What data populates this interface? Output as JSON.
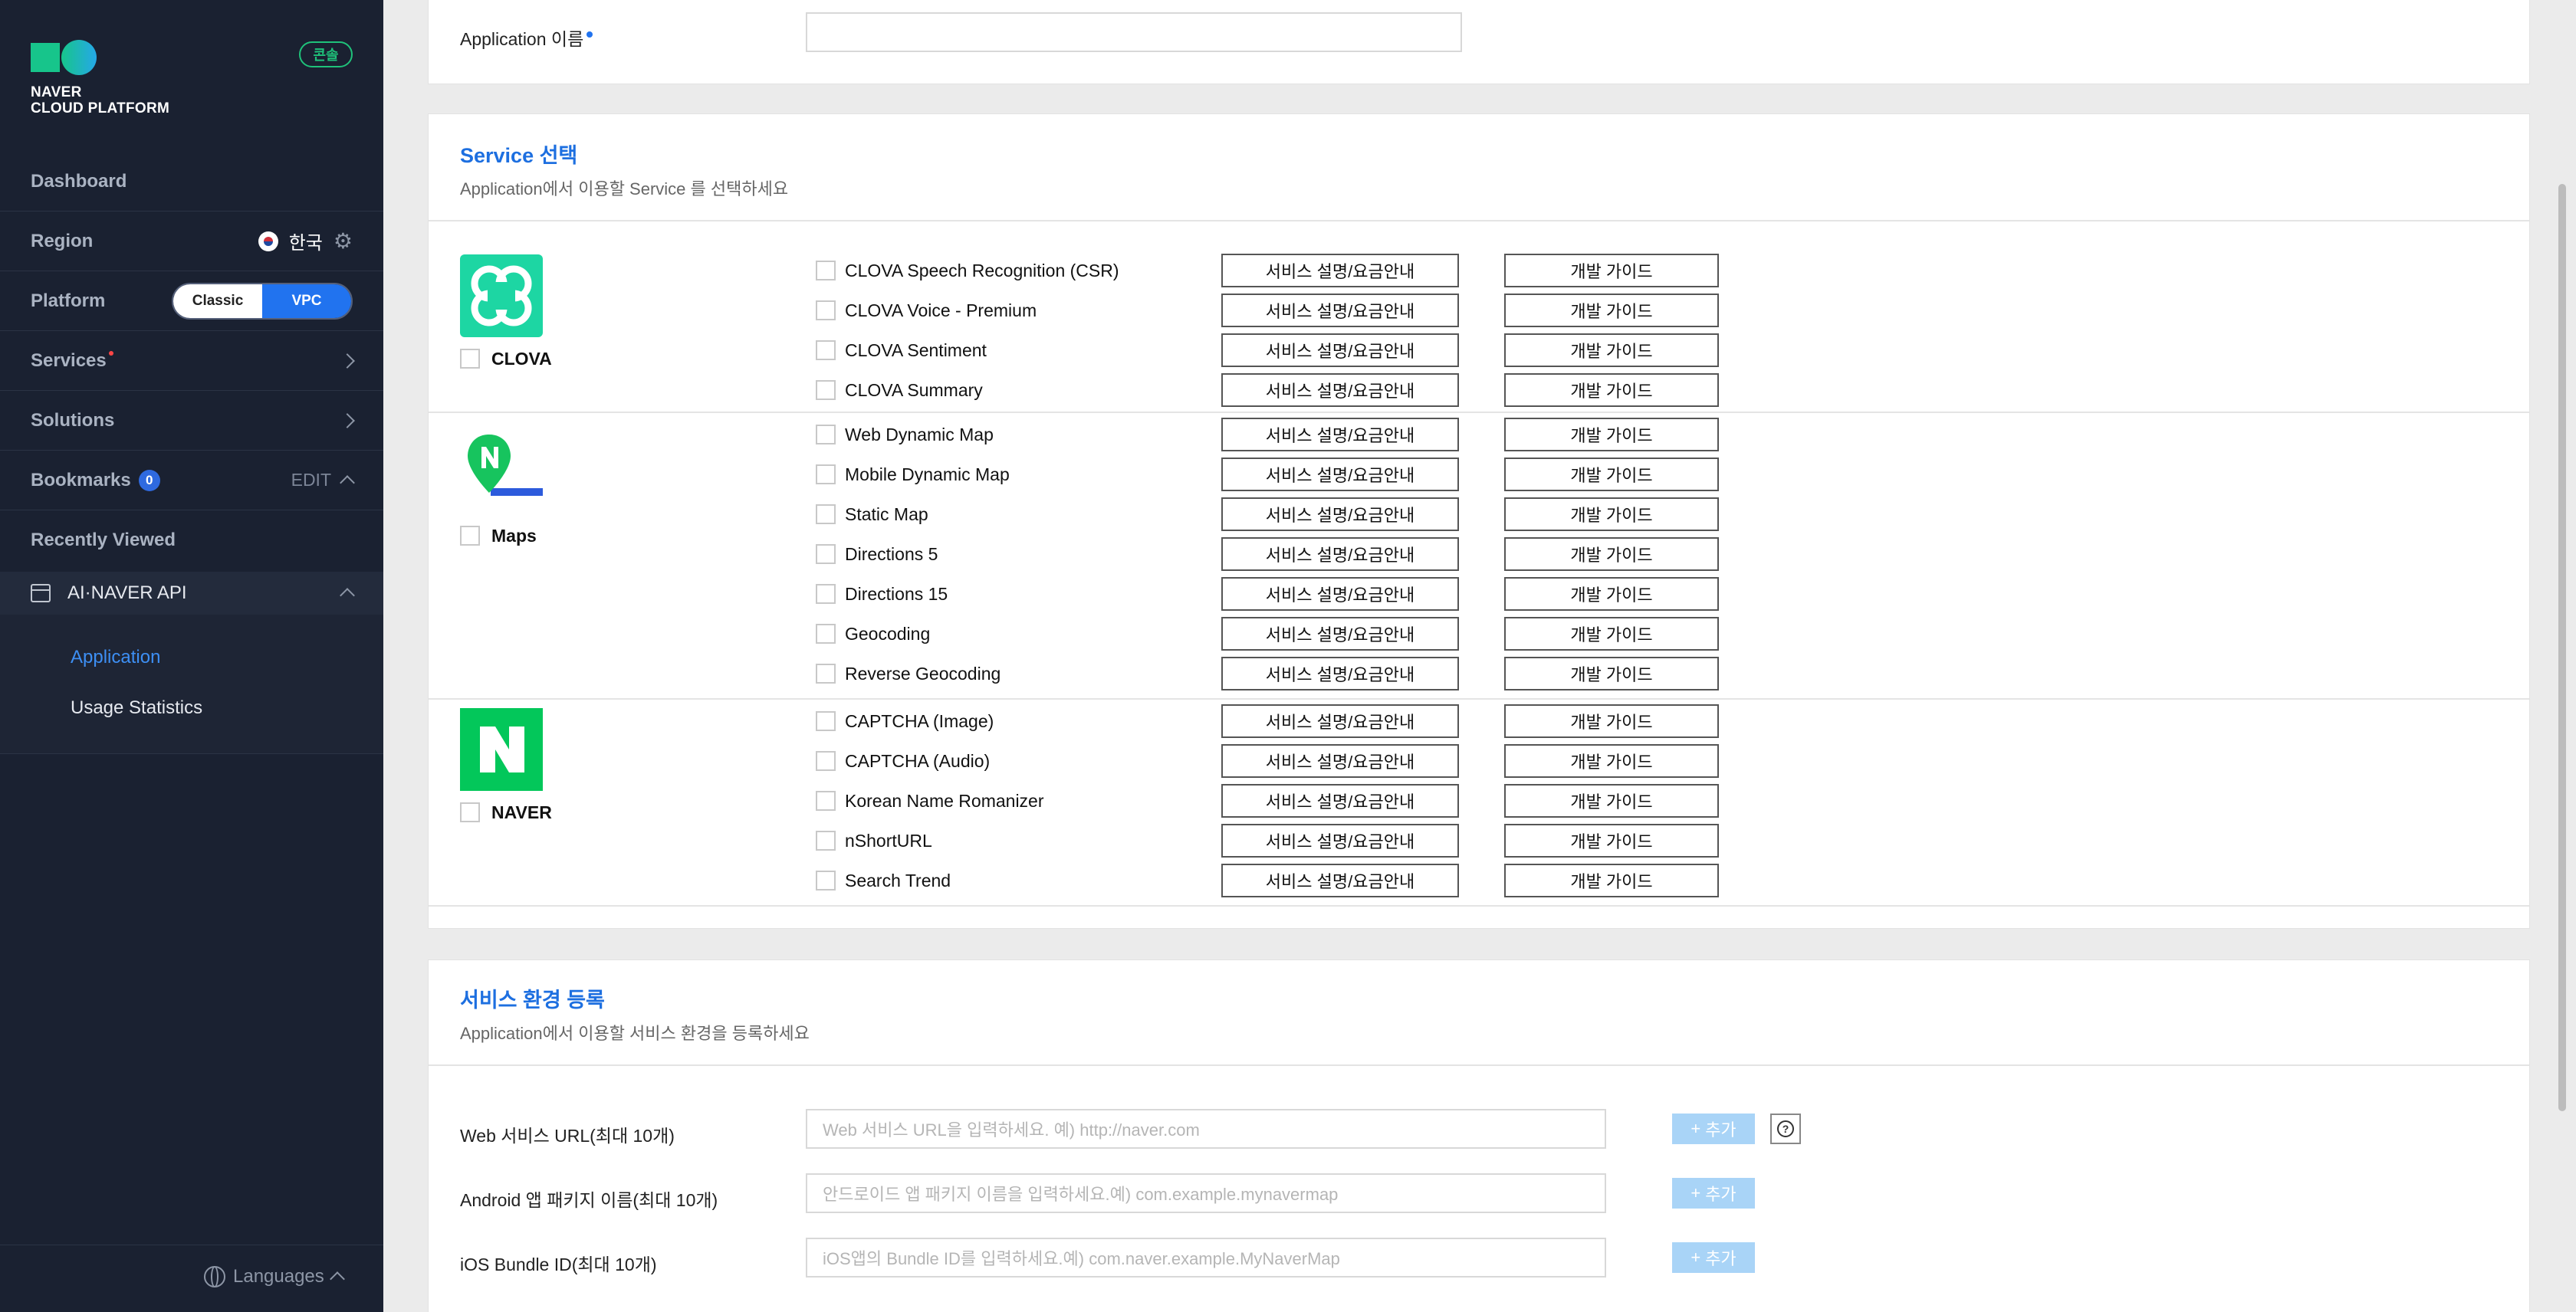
{
  "sidebar": {
    "logo_line1": "NAVER",
    "logo_line2": "CLOUD PLATFORM",
    "console_badge": "콘솔",
    "dashboard": "Dashboard",
    "region_label": "Region",
    "region_value": "한국",
    "platform_label": "Platform",
    "platform_classic": "Classic",
    "platform_vpc": "VPC",
    "services": "Services",
    "solutions": "Solutions",
    "bookmarks": "Bookmarks",
    "bookmarks_count": "0",
    "bookmarks_edit": "EDIT",
    "recently_viewed": "Recently Viewed",
    "api_group": "AI·NAVER API",
    "sub_items": [
      "Application",
      "Usage Statistics"
    ],
    "languages": "Languages"
  },
  "app_name": {
    "label": "Application 이름"
  },
  "service_select": {
    "title": "Service 선택",
    "subtitle": "Application에서 이용할 Service 를 선택하세요",
    "desc_button": "서비스 설명/요금안내",
    "guide_button": "개발 가이드",
    "groups": [
      {
        "name": "CLOVA",
        "services": [
          "CLOVA Speech Recognition (CSR)",
          "CLOVA Voice - Premium",
          "CLOVA Sentiment",
          "CLOVA Summary"
        ]
      },
      {
        "name": "Maps",
        "services": [
          "Web Dynamic Map",
          "Mobile Dynamic Map",
          "Static Map",
          "Directions 5",
          "Directions 15",
          "Geocoding",
          "Reverse Geocoding"
        ]
      },
      {
        "name": "NAVER",
        "services": [
          "CAPTCHA (Image)",
          "CAPTCHA (Audio)",
          "Korean Name Romanizer",
          "nShortURL",
          "Search Trend"
        ]
      }
    ]
  },
  "service_env": {
    "title": "서비스 환경 등록",
    "subtitle": "Application에서 이용할 서비스 환경을 등록하세요",
    "add_label": "추가",
    "fields": [
      {
        "label": "Web 서비스 URL(최대 10개)",
        "placeholder": "Web 서비스 URL을 입력하세요. 예) http://naver.com"
      },
      {
        "label": "Android 앱 패키지 이름(최대 10개)",
        "placeholder": "안드로이드 앱 패키지 이름을 입력하세요.예) com.example.mynavermap"
      },
      {
        "label": "iOS Bundle ID(최대 10개)",
        "placeholder": "iOS앱의 Bundle ID를 입력하세요.예) com.naver.example.MyNaverMap"
      }
    ]
  },
  "colors": {
    "sidebar_bg": "#1a2131",
    "accent": "#2173ef",
    "title_blue": "#1d6fe0",
    "brand_green": "#1fc27a",
    "naver_green": "#03c75a"
  }
}
